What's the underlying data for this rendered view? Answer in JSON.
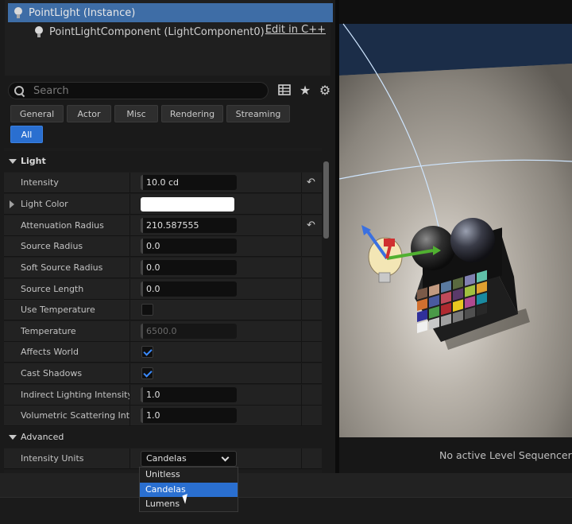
{
  "component_tree": {
    "root_label": "PointLight (Instance)",
    "child_label": "PointLightComponent (LightComponent0)",
    "edit_link": "Edit in C++"
  },
  "search": {
    "placeholder": "Search"
  },
  "toolbar_icons": [
    "table-view-icon",
    "star-icon",
    "gear-icon"
  ],
  "filter_tabs": [
    "General",
    "Actor",
    "Misc",
    "Rendering",
    "Streaming",
    "All"
  ],
  "active_tab": "All",
  "categories": {
    "light": "Light",
    "advanced": "Advanced"
  },
  "properties": {
    "intensity": {
      "label": "Intensity",
      "value": "10.0 cd"
    },
    "light_color": {
      "label": "Light Color",
      "color": "#ffffff"
    },
    "attenuation_radius": {
      "label": "Attenuation Radius",
      "value": "210.587555"
    },
    "source_radius": {
      "label": "Source Radius",
      "value": "0.0"
    },
    "soft_source_radius": {
      "label": "Soft Source Radius",
      "value": "0.0"
    },
    "source_length": {
      "label": "Source Length",
      "value": "0.0"
    },
    "use_temperature": {
      "label": "Use Temperature",
      "checked": false
    },
    "temperature": {
      "label": "Temperature",
      "value": "6500.0"
    },
    "affects_world": {
      "label": "Affects World",
      "checked": true
    },
    "cast_shadows": {
      "label": "Cast Shadows",
      "checked": true
    },
    "indirect_lighting_intensity": {
      "label": "Indirect Lighting Intensity",
      "value": "1.0"
    },
    "volumetric_scattering_intensity": {
      "label": "Volumetric Scattering Inten...",
      "value": "1.0"
    },
    "intensity_units": {
      "label": "Intensity Units",
      "value": "Candelas"
    }
  },
  "dropdown": {
    "options": [
      "Unitless",
      "Candelas",
      "Lumens"
    ],
    "highlighted": "Candelas"
  },
  "viewport": {
    "status_text": "No active Level Sequencer de",
    "accent_colors": {
      "x_axis": "#d03030",
      "y_axis": "#50b030",
      "z_axis": "#3a70e0",
      "selection": "#2a6fd0"
    }
  }
}
